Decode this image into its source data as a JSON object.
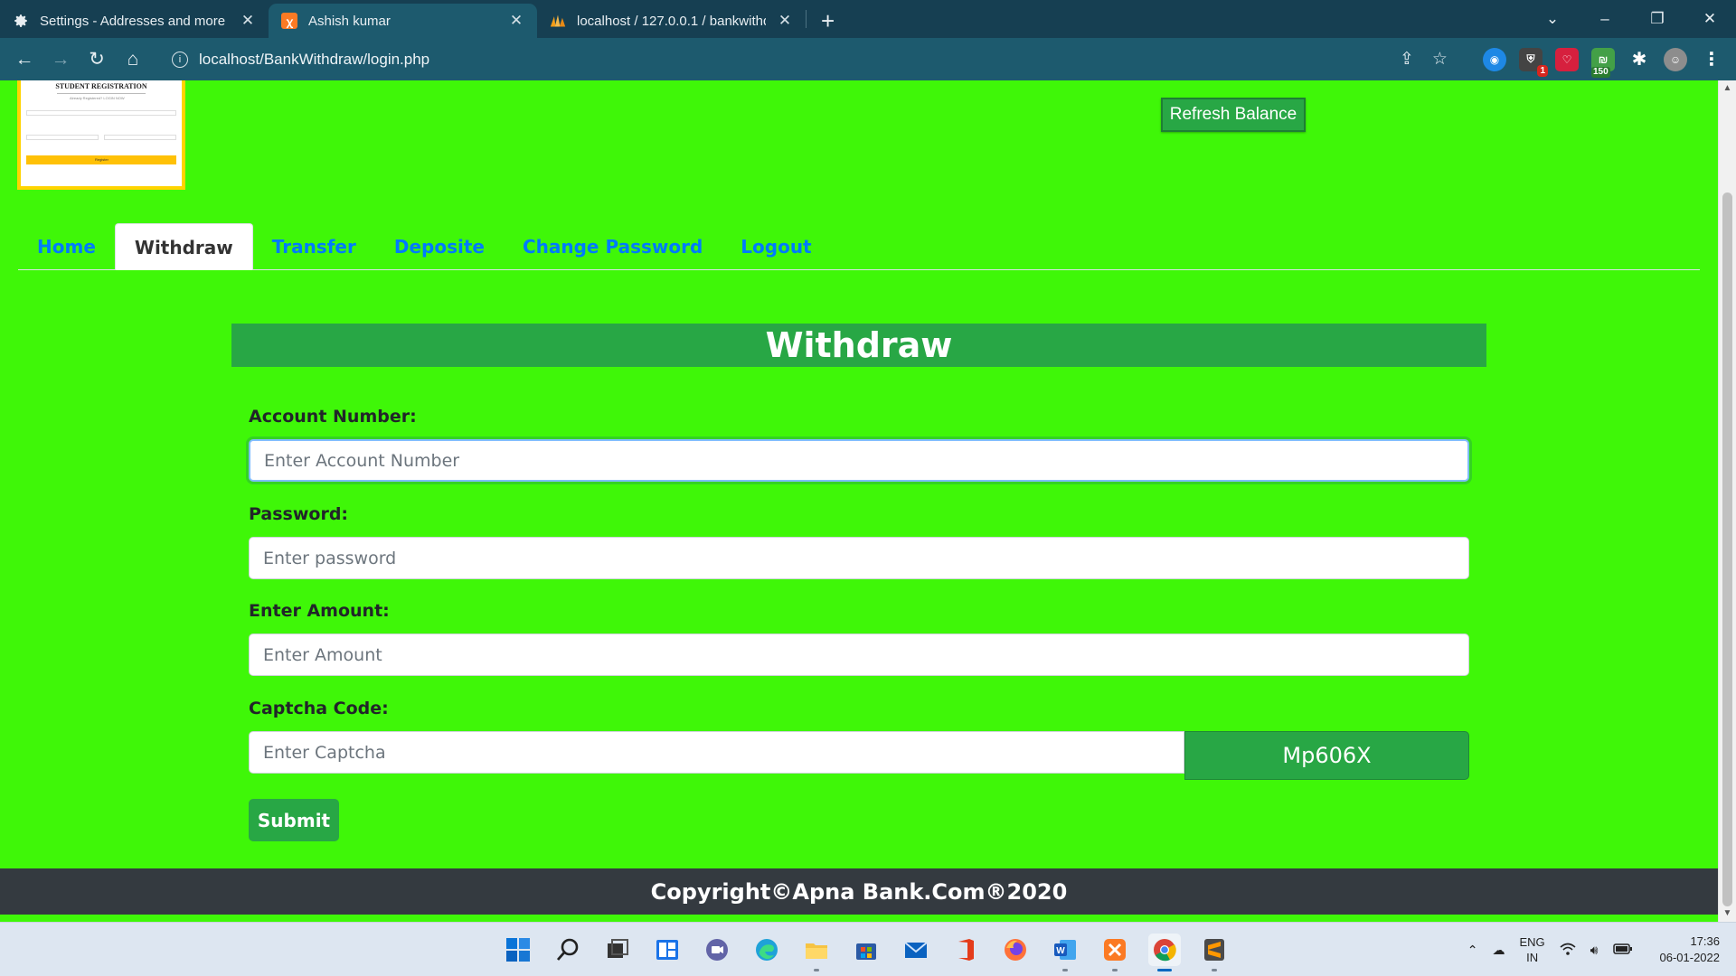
{
  "browser": {
    "tabs": [
      {
        "title": "Settings - Addresses and more",
        "icon": "gear-icon"
      },
      {
        "title": "Ashish kumar",
        "icon": "xampp-icon"
      },
      {
        "title": "localhost / 127.0.0.1 / bankwithdraw",
        "icon": "phpmyadmin-icon"
      }
    ],
    "url": "localhost/BankWithdraw/login.php",
    "extensions": {
      "shield_badge": "1",
      "counter_badge": "150"
    }
  },
  "page": {
    "refresh_button": "Refresh Balance",
    "logo_image_text": {
      "title": "STUDENT REGISTRATION",
      "line": "Already Registered? LOGIN NOW",
      "button": "Register"
    },
    "nav": [
      "Home",
      "Withdraw",
      "Transfer",
      "Deposite",
      "Change Password",
      "Logout"
    ],
    "active_tab": "Withdraw",
    "panel_title": "Withdraw",
    "form": {
      "account_label": "Account Number:",
      "account_placeholder": "Enter Account Number",
      "password_label": "Password:",
      "password_placeholder": "Enter password",
      "amount_label": "Enter Amount:",
      "amount_placeholder": "Enter Amount",
      "captcha_label": "Captcha Code:",
      "captcha_placeholder": "Enter Captcha",
      "captcha_code": "Mp606X",
      "submit": "Submit"
    },
    "footer": "Copyright©Apna Bank.Com®2020",
    "colors": {
      "background": "#3ff708",
      "accent": "#28a745",
      "footer": "#343a40",
      "link": "#007bff"
    }
  },
  "taskbar": {
    "lang": [
      "ENG",
      "IN"
    ],
    "time": "17:36",
    "date": "06-01-2022"
  }
}
